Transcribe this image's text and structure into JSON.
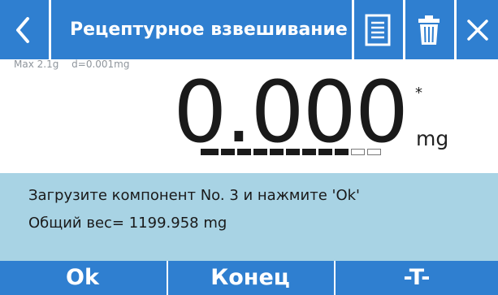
{
  "header": {
    "title": "Рецептурное взвешивание",
    "icons": [
      "back-icon",
      "report-icon",
      "trash-icon",
      "close-icon"
    ]
  },
  "specs": {
    "max": "Max 2.1g",
    "division": "d=0.001mg"
  },
  "reading": {
    "value": "0.000",
    "unit": "mg",
    "stability_mark": "*"
  },
  "load_indicator": {
    "filled_segments": 9,
    "total_segments": 11
  },
  "message": {
    "line1": "Загрузите компонент No. 3 и нажмите 'Ok'",
    "line2": "Общий вес= 1199.958 mg"
  },
  "footer": {
    "ok_label": "Ok",
    "end_label": "Конец",
    "tare_label": "-T-"
  },
  "colors": {
    "bar": "#2f7fd0",
    "message_bg": "#a8d3e4"
  }
}
